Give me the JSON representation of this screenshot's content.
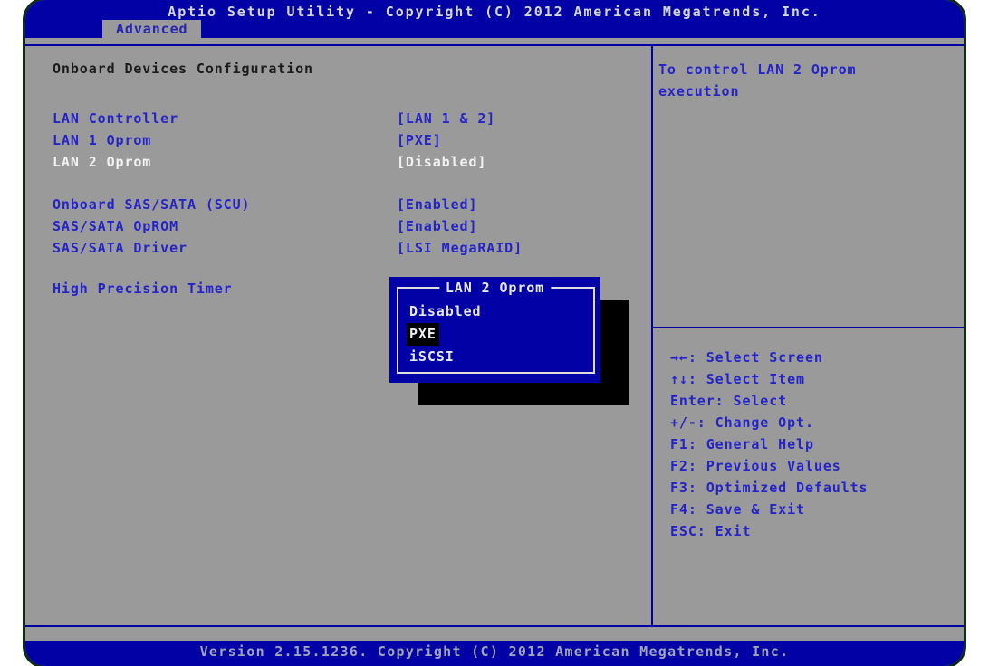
{
  "colors": {
    "bios_blue": "#0101a6",
    "panel_gray": "#9a9a9a",
    "item_blue": "#2424c8",
    "selected_white": "#f2f2f2",
    "highlight_black": "#000000",
    "frame_green": "#0d2a12"
  },
  "header": {
    "title": "Aptio Setup Utility - Copyright (C) 2012 American Megatrends, Inc."
  },
  "tabs": {
    "active": "Advanced"
  },
  "left_panel": {
    "section_title": "Onboard Devices Configuration",
    "items": [
      {
        "label": "LAN Controller",
        "value": "[LAN 1 & 2]"
      },
      {
        "label": "LAN 1 Oprom",
        "value": "[PXE]"
      },
      {
        "label": "LAN 2 Oprom",
        "value": "[Disabled]"
      },
      {
        "label": "Onboard SAS/SATA (SCU)",
        "value": "[Enabled]"
      },
      {
        "label": "SAS/SATA OpROM",
        "value": "[Enabled]"
      },
      {
        "label": "SAS/SATA Driver",
        "value": "[LSI MegaRAID]"
      },
      {
        "label": "High Precision Timer",
        "value": ""
      }
    ],
    "selected_item": "LAN 2 Oprom"
  },
  "popup": {
    "title": "LAN 2 Oprom",
    "options": [
      {
        "label": "Disabled"
      },
      {
        "label": "PXE"
      },
      {
        "label": "iSCSI"
      }
    ],
    "highlighted_option": "PXE"
  },
  "help_panel": {
    "line1": "To control LAN 2 Oprom",
    "line2": "execution"
  },
  "legend": {
    "items": [
      "→←: Select Screen",
      "↑↓: Select Item",
      "Enter: Select",
      "+/-: Change Opt.",
      "F1: General Help",
      "F2: Previous Values",
      "F3: Optimized Defaults",
      "F4: Save & Exit",
      "ESC: Exit"
    ]
  },
  "footer": {
    "text": "Version 2.15.1236. Copyright (C) 2012 American Megatrends, Inc."
  }
}
